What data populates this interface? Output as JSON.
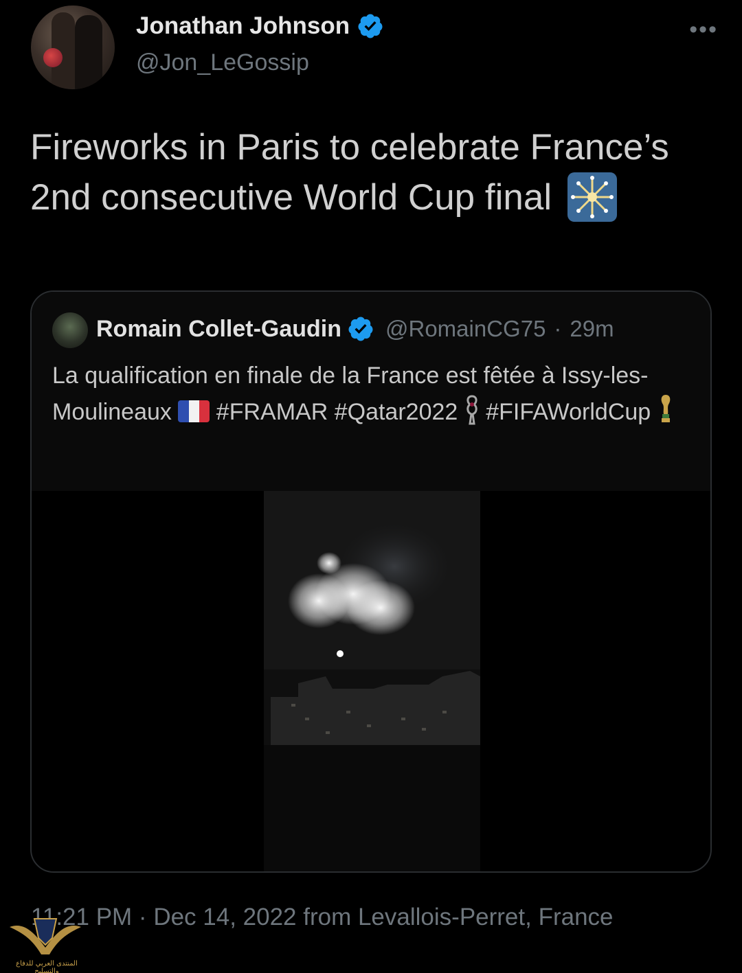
{
  "author": {
    "name": "Jonathan Johnson",
    "handle": "@Jon_LeGossip",
    "verified": true
  },
  "more_label": "•••",
  "tweet": {
    "text": "Fireworks in Paris to celebrate France’s 2nd consecutive World Cup final",
    "emoji": "sparkler-icon"
  },
  "quoted_tweet": {
    "author_name": "Romain Collet-Gaudin",
    "author_handle": "@RomainCG75",
    "separator": "·",
    "time_ago": "29m",
    "text_part1": "La qualification en finale de la France est fêtée à Issy-les-Moulineaux",
    "hashtag1": "#FRAMAR",
    "hashtag2": "#Qatar2022",
    "hashtag3": "#FIFAWorldCup",
    "media": "video-fireworks"
  },
  "footer": {
    "timestamp": "11:21 PM · Dec 14, 2022 from Levallois-Perret, France"
  },
  "watermark": {
    "text": "المنتدى العربي للدفاع والتسليح"
  },
  "colors": {
    "background": "#000000",
    "verified_blue": "#1d9bf0",
    "secondary_text": "#6e767d"
  }
}
